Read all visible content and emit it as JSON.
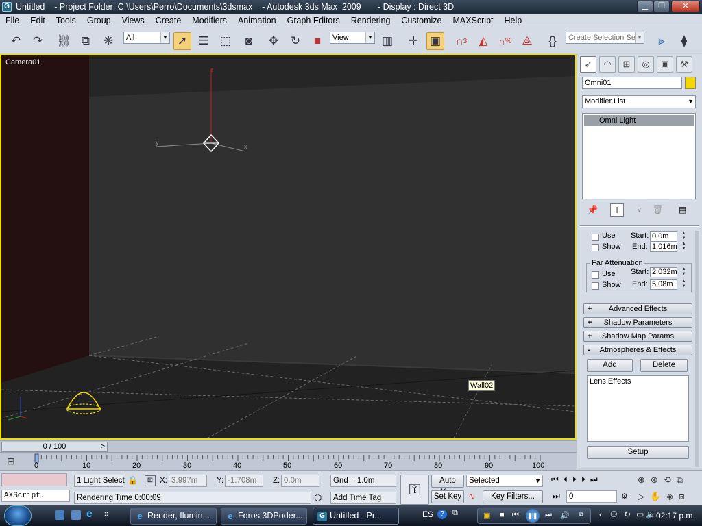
{
  "window": {
    "app_icon": "3dsmax-logo-icon",
    "title": "Untitled    - Project Folder: C:\\Users\\Perro\\Documents\\3dsmax    - Autodesk 3ds Max  2009       - Display : Direct 3D",
    "minimize": "▁",
    "maximize": "❐",
    "close": "✕"
  },
  "menu": [
    "File",
    "Edit",
    "Tools",
    "Group",
    "Views",
    "Create",
    "Modifiers",
    "Animation",
    "Graph Editors",
    "Rendering",
    "Customize",
    "MAXScript",
    "Help"
  ],
  "toolbar": {
    "selection_filter": "All",
    "reference_coord": "View",
    "named_selection_placeholder": "Create Selection Set",
    "snap_label": "3",
    "percent_snap_label": "%"
  },
  "viewport": {
    "label": "Camera01",
    "axis_z": "z",
    "axis_y": "y",
    "axis_x": "x",
    "tooltip": "Wall02"
  },
  "command_panel": {
    "object_name": "Omni01",
    "object_color": "#f2d800",
    "modifier_list": "Modifier List",
    "stack_items": [
      "Omni Light"
    ],
    "near_atten": {
      "use_label": "Use",
      "show_label": "Show",
      "start_label": "Start:",
      "start_value": "0.0m",
      "end_label": "End:",
      "end_value": "1.016m"
    },
    "far_atten": {
      "group_label": "Far Attenuation",
      "use_label": "Use",
      "show_label": "Show",
      "start_label": "Start:",
      "start_value": "2.032m",
      "end_label": "End:",
      "end_value": "5.08m"
    },
    "rollouts": [
      {
        "sign": "+",
        "label": "Advanced Effects"
      },
      {
        "sign": "+",
        "label": "Shadow Parameters"
      },
      {
        "sign": "+",
        "label": "Shadow Map Params"
      },
      {
        "sign": "-",
        "label": "Atmospheres & Effects"
      }
    ],
    "add_button": "Add",
    "delete_button": "Delete",
    "effects_list": [
      "Lens Effects"
    ],
    "setup_button": "Setup"
  },
  "timeline": {
    "frame_display": "0 / 100",
    "ticks": [
      "0",
      "10",
      "20",
      "30",
      "40",
      "50",
      "60",
      "70",
      "80",
      "90",
      "100"
    ]
  },
  "status": {
    "maxscript_label": "AXScript.",
    "selection_info": "1 Light Select",
    "x_label": "X:",
    "x_value": "3.997m",
    "y_label": "Y:",
    "y_value": "-1.708m",
    "z_label": "Z:",
    "z_value": "0.0m",
    "grid": "Grid = 1.0m",
    "rendering_time": "Rendering Time  0:00:09",
    "add_time_tag": "Add Time Tag",
    "auto_key": "Auto Key",
    "set_key": "Set Key",
    "key_mode": "Selected",
    "key_filters": "Key Filters...",
    "current_frame": "0"
  },
  "taskbar": {
    "tasks": [
      {
        "label": "Render, Ilumin...",
        "icon": "ie-icon",
        "active": false
      },
      {
        "label": "Foros 3DPoder....",
        "icon": "ie-icon",
        "active": false
      },
      {
        "label": "Untitled     - Pr...",
        "icon": "3dsmax-icon",
        "active": true
      }
    ],
    "language": "ES",
    "clock": "02:17 p.m."
  }
}
